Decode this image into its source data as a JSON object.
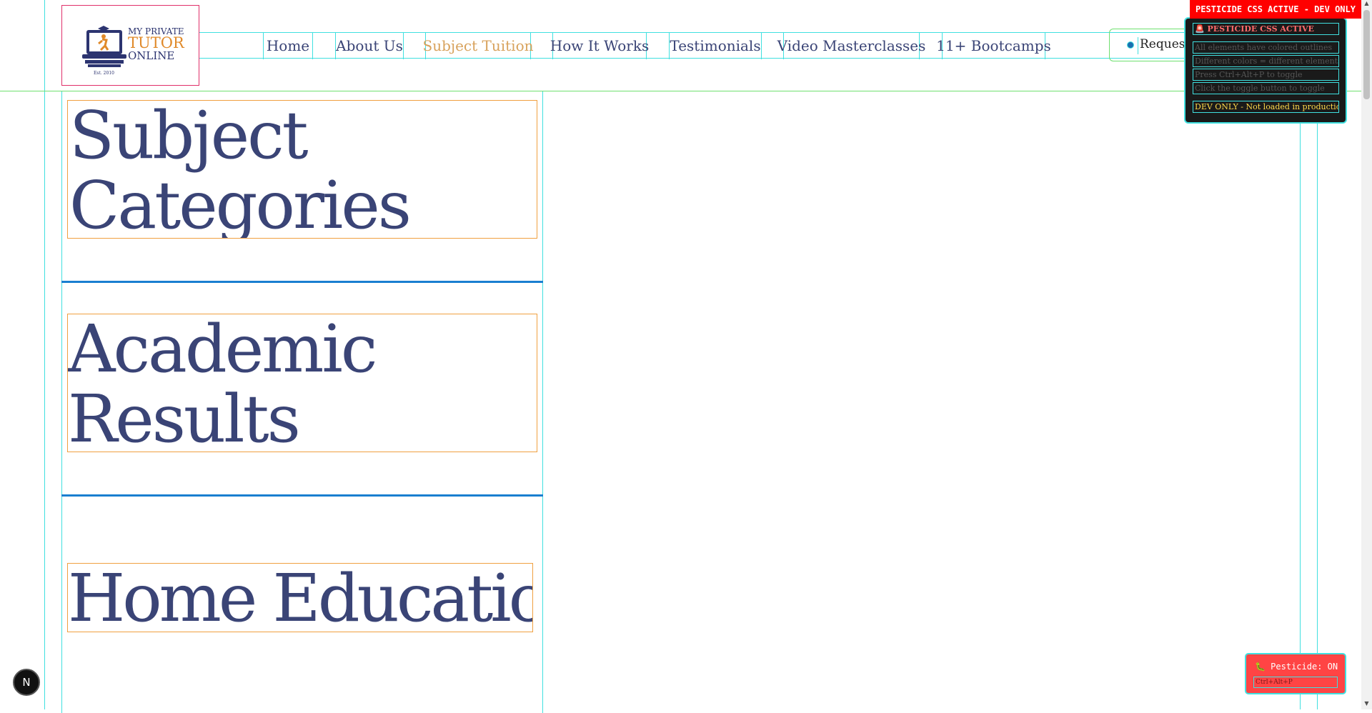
{
  "header": {
    "logo": {
      "line1": "MY PRIVATE",
      "line2": "TUTOR",
      "line3": "ONLINE",
      "est": "Est. 2010"
    },
    "nav": [
      {
        "label": "Home",
        "active": false
      },
      {
        "label": "About Us",
        "active": false
      },
      {
        "label": "Subject Tuition",
        "active": true
      },
      {
        "label": "How It Works",
        "active": false
      },
      {
        "label": "Testimonials",
        "active": false
      },
      {
        "label": "Video Masterclasses",
        "active": false
      },
      {
        "label": "11+ Bootcamps",
        "active": false
      }
    ],
    "cta_label": "Request"
  },
  "dev_badge": "PESTICIDE CSS ACTIVE - DEV ONLY",
  "dev_panel": {
    "title": "🚨 PESTICIDE CSS ACTIVE",
    "rows": [
      "All elements have colored outlines",
      "Different colors = different elements",
      "Press Ctrl+Alt+P to toggle",
      "Click the toggle button to toggle"
    ],
    "note": "DEV ONLY - Not loaded in production"
  },
  "main": {
    "headings": [
      "Subject Categories",
      "Academic Results",
      "Home Education"
    ]
  },
  "toggle": {
    "label": "🐛 Pesticide: ON",
    "shortcut": "Ctrl+Alt+P"
  },
  "fab_letter": "N",
  "colors": {
    "heading": "#3a4476",
    "accent": "#d8a25c",
    "badge": "#ff0000",
    "outline_cyan": "#40e0e0",
    "outline_orange": "#f0a040"
  }
}
